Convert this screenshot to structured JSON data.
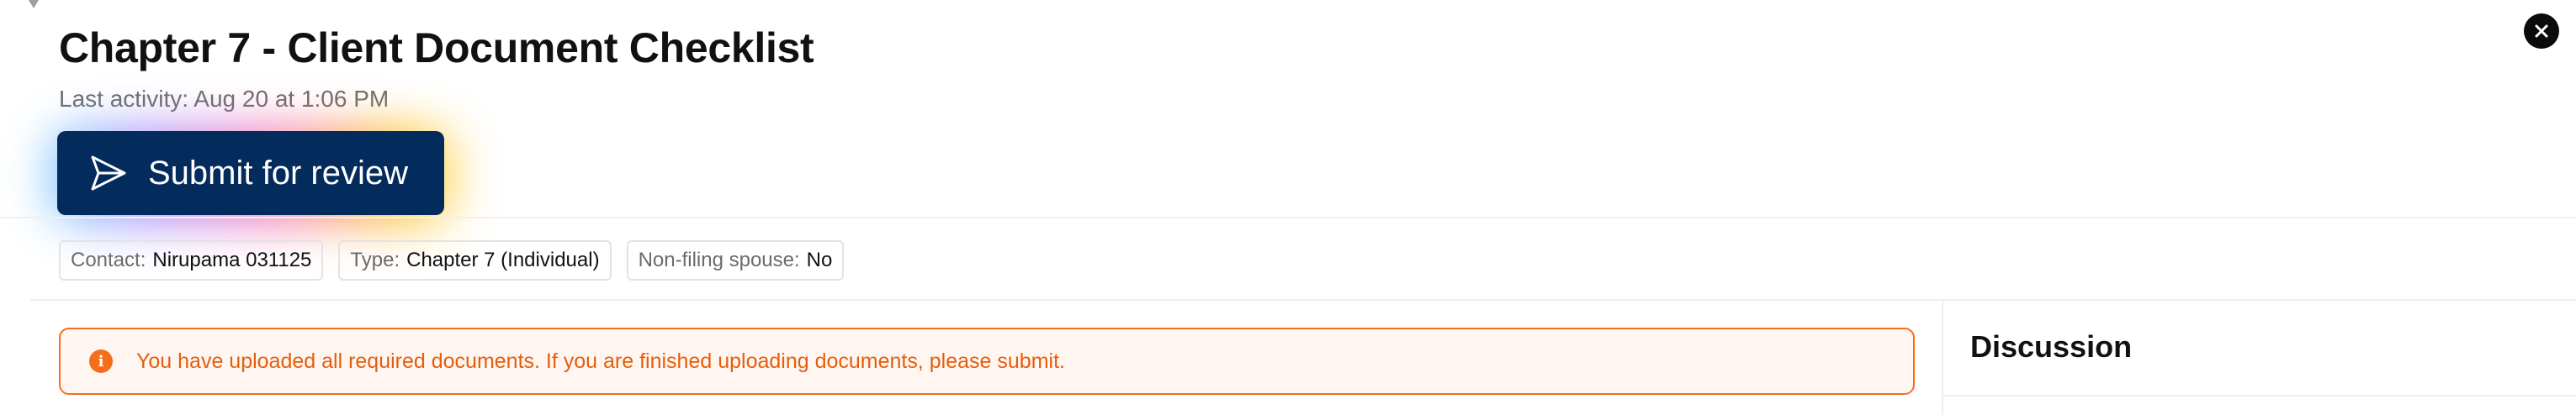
{
  "header": {
    "title": "Chapter 7 - Client Document Checklist",
    "last_activity": "Last activity: Aug 20 at 1:06 PM"
  },
  "actions": {
    "submit_label": "Submit for review",
    "submit_icon": "send-icon",
    "close_icon": "close-icon"
  },
  "chips": [
    {
      "label": "Contact:",
      "value": "Nirupama 031125"
    },
    {
      "label": "Type:",
      "value": "Chapter 7 (Individual)"
    },
    {
      "label": "Non-filing spouse:",
      "value": "No"
    }
  ],
  "alert": {
    "icon": "info-icon",
    "message": "You have uploaded all required documents. If you are finished uploading documents, please submit.",
    "color": "#f56e1c"
  },
  "discussion": {
    "title": "Discussion"
  },
  "colors": {
    "primary": "#032b5c",
    "warning": "#f56e1c"
  }
}
